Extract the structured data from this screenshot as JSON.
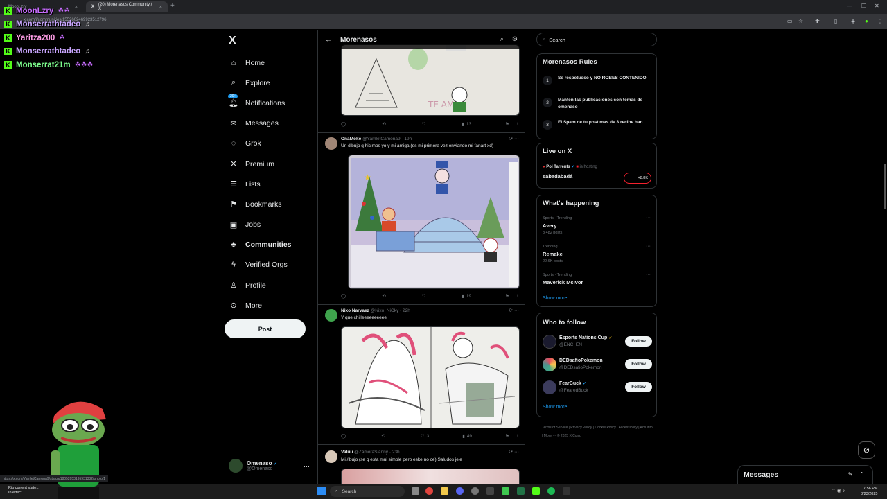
{
  "browser": {
    "tabs": [
      {
        "label": "MoonLzry",
        "active": false
      },
      {
        "label": "(20) Morenasos Community / X",
        "active": true
      }
    ],
    "url": "x.com/i/communities/1552602469923512796",
    "status_url": "https://x.com/YamletCamona9/status/18052053195931332/photo/1"
  },
  "chat": [
    {
      "name": "MoonLzry",
      "color": "#c86cff",
      "emote": "☘☘"
    },
    {
      "name": "Monserrathtadeo",
      "color": "#c9a6ff",
      "emote": "♫"
    },
    {
      "name": "Yaritza200",
      "color": "#ff9de6",
      "emote": "☘"
    },
    {
      "name": "Monserrathtadeo",
      "color": "#c9a6ff",
      "emote": "♫"
    },
    {
      "name": "Monserrat21m",
      "color": "#7cfc8c",
      "emote": "☘☘☘"
    }
  ],
  "nav": {
    "logo": "X",
    "notif_badge": "20+",
    "items": [
      {
        "label": "Home",
        "icon": "⌂",
        "name": "home"
      },
      {
        "label": "Explore",
        "icon": "⌕",
        "name": "explore"
      },
      {
        "label": "Notifications",
        "icon": "♫",
        "name": "notifications"
      },
      {
        "label": "Messages",
        "icon": "✉",
        "name": "messages"
      },
      {
        "label": "Grok",
        "icon": "◌",
        "name": "grok"
      },
      {
        "label": "Premium",
        "icon": "✕",
        "name": "premium"
      },
      {
        "label": "Lists",
        "icon": "☰",
        "name": "lists"
      },
      {
        "label": "Bookmarks",
        "icon": "⚑",
        "name": "bookmarks"
      },
      {
        "label": "Jobs",
        "icon": "▣",
        "name": "jobs"
      },
      {
        "label": "Communities",
        "icon": "♣",
        "name": "communities"
      },
      {
        "label": "Verified Orgs",
        "icon": "ϟ",
        "name": "verified-orgs"
      },
      {
        "label": "Profile",
        "icon": "♙",
        "name": "profile"
      },
      {
        "label": "More",
        "icon": "⊙",
        "name": "more"
      }
    ],
    "post_label": "Post",
    "account": {
      "name": "Omenaso",
      "handle": "@Omenaso"
    }
  },
  "community": {
    "title": "Morenasos",
    "posts": [
      {
        "name": "",
        "handle": "",
        "time": "",
        "text": "",
        "actions": {
          "reply": "",
          "repost": "",
          "like": "",
          "views": "13"
        }
      },
      {
        "name": "OñaMoke",
        "handle": "@YamletCamona9",
        "time": "· 19h",
        "text": "Un dibujo q hicimos yo y mi amiga (es mi primera vez enviando mi fanart xd)",
        "actions": {
          "reply": "",
          "repost": "",
          "like": "",
          "views": "19"
        }
      },
      {
        "name": "Nixo Narvaez",
        "handle": "@Nixo_NiCky",
        "time": "· 22h",
        "text": "Y que chilleeeeeeeeee",
        "actions": {
          "reply": "",
          "repost": "",
          "like": "3",
          "views": "49"
        }
      },
      {
        "name": "Valuu",
        "handle": "@ZamoraSianny",
        "time": "· 23h",
        "text": "Mi /ibujo (se q esta mui simple pero eske no ce) Saludos jeje"
      }
    ]
  },
  "search": {
    "placeholder": "Search"
  },
  "rules": {
    "title": "Morenasos Rules",
    "items": [
      {
        "num": "1",
        "text": "Se respetuoso y NO ROBES CONTENIDO"
      },
      {
        "num": "2",
        "text": "Manten las publicaciones con temas de omenaso"
      },
      {
        "num": "3",
        "text": "El Spam de tu post mas de 3 recibe ban"
      }
    ]
  },
  "live": {
    "title": "Live on X",
    "host": "Pol Tarrents",
    "host_suffix": "is hosting",
    "space": "sabadabadá",
    "count": "+8.8K"
  },
  "happening": {
    "title": "What's happening",
    "trends": [
      {
        "cat": "Sports · Trending",
        "name": "Avery",
        "count": "8,482 posts"
      },
      {
        "cat": "Trending",
        "name": "Remake",
        "count": "22.6K posts"
      },
      {
        "cat": "Sports · Trending",
        "name": "Maverick McIvor",
        "count": ""
      }
    ],
    "show_more": "Show more"
  },
  "who_to_follow": {
    "title": "Who to follow",
    "items": [
      {
        "name": "Esports Nations Cup",
        "handle": "@ENC_EN",
        "badge": "gold",
        "av": "#1a1a2e"
      },
      {
        "name": "DEDsafioPokemon",
        "handle": "@DEDsafioPokemon",
        "badge": "",
        "av": "#e84a5f"
      },
      {
        "name": "FearBuck",
        "handle": "@FearedBuck",
        "badge": "blue",
        "av": "#3b3b5c"
      }
    ],
    "follow_label": "Follow",
    "show_more": "Show more"
  },
  "footer": {
    "links": "Terms of Service  |  Privacy Policy  |  Cookie Policy  |  Accessibility  |  Ads info  |  More ···  © 2025 X Corp."
  },
  "messages_bar": {
    "label": "Messages"
  },
  "taskbar": {
    "weather_line1": "Rip current state...",
    "weather_line2": "In effect",
    "search": "Search",
    "time": "7:56 PM",
    "date": "8/23/2025"
  }
}
